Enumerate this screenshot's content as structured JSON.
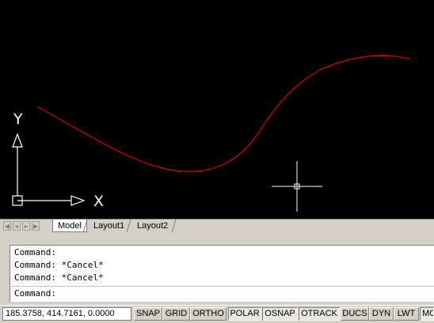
{
  "viewport": {
    "background": "#000000",
    "curve_color": "#e00000",
    "axis_x_label": "X",
    "axis_y_label": "Y"
  },
  "layout_tabs": {
    "nav_icons": [
      "first-tab-icon",
      "prev-tab-icon",
      "next-tab-icon",
      "last-tab-icon"
    ],
    "tabs": [
      {
        "label": "Model",
        "active": true
      },
      {
        "label": "Layout1",
        "active": false
      },
      {
        "label": "Layout2",
        "active": false
      }
    ]
  },
  "command": {
    "history": [
      "Command:",
      "Command: *Cancel*",
      "Command: *Cancel*"
    ],
    "prompt": "Command:"
  },
  "status": {
    "coordinates": "185.3758, 414.7161, 0.0000",
    "buttons": [
      {
        "label": "SNAP",
        "on": false
      },
      {
        "label": "GRID",
        "on": false
      },
      {
        "label": "ORTHO",
        "on": false
      },
      {
        "label": "POLAR",
        "on": true
      },
      {
        "label": "OSNAP",
        "on": true
      },
      {
        "label": "OTRACK",
        "on": true
      },
      {
        "label": "DUCS",
        "on": false
      },
      {
        "label": "DYN",
        "on": false
      },
      {
        "label": "LWT",
        "on": false
      },
      {
        "label": "MODEL",
        "on": true
      }
    ]
  }
}
